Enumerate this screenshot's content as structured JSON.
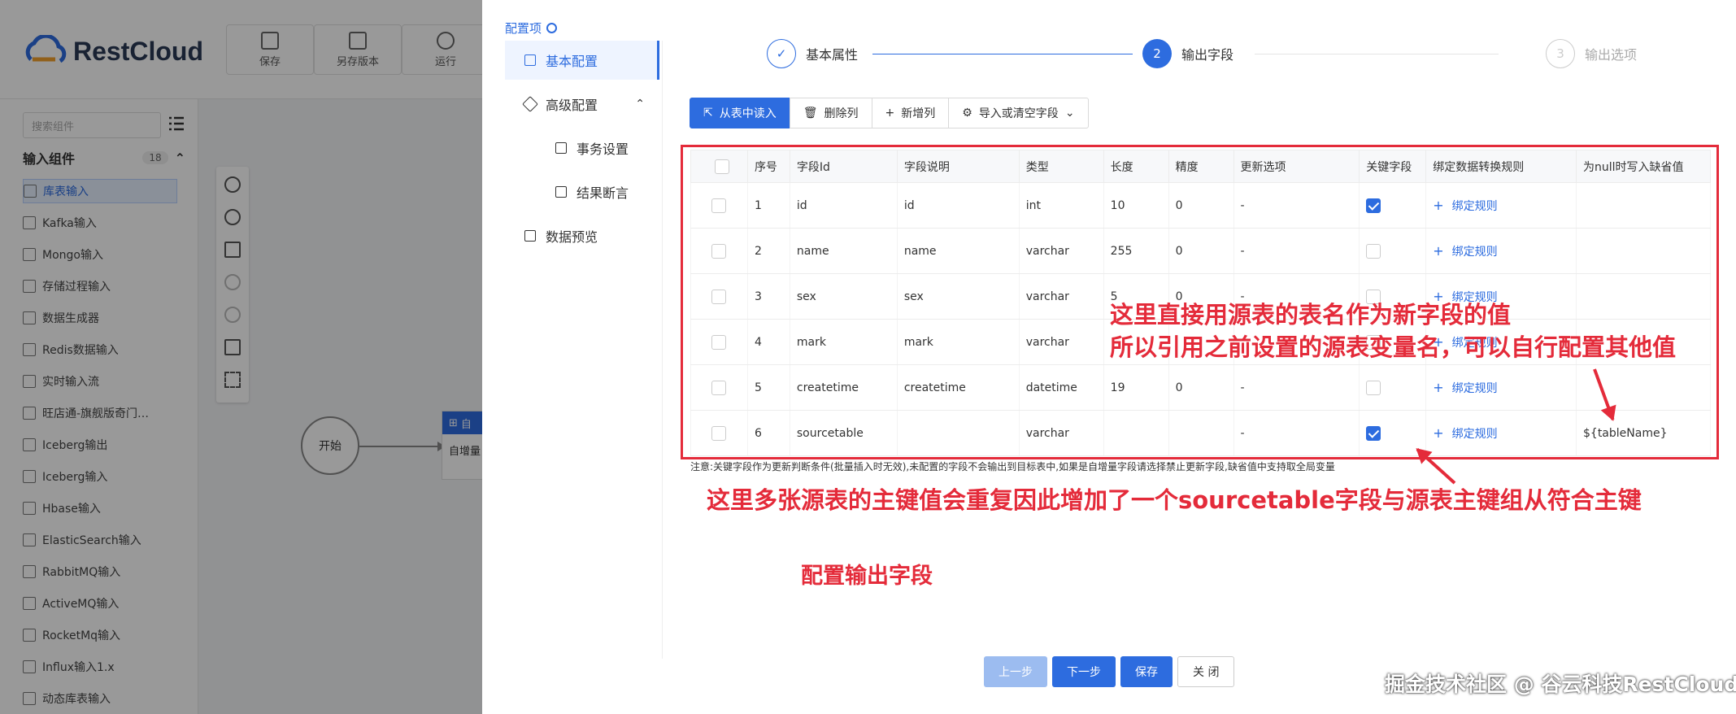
{
  "app": {
    "brand": "RestCloud",
    "toolbar": [
      "保存",
      "另存版本",
      "运行"
    ],
    "search_placeholder": "搜索组件",
    "group": {
      "label": "输入组件",
      "count": "18"
    },
    "components": [
      "库表输入",
      "Kafka输入",
      "Mongo输入",
      "存储过程输入",
      "数据生成器",
      "Redis数据输入",
      "实时输入流",
      "旺店通-旗舰版奇门…",
      "Iceberg输出",
      "Iceberg输入",
      "Hbase输入",
      "ElasticSearch输入",
      "RabbitMQ输入",
      "ActiveMQ输入",
      "RocketMq输入",
      "Influx输入1.x",
      "动态库表输入"
    ],
    "canvas": {
      "start_node": "开始",
      "task_head": "自",
      "task_body": "自增量"
    }
  },
  "dialog": {
    "config_title": "配置项",
    "nav": [
      {
        "label": "基本配置",
        "active": true
      },
      {
        "label": "高级配置",
        "caret": "^"
      },
      {
        "label": "事务设置",
        "sub": true
      },
      {
        "label": "结果断言",
        "sub": true
      },
      {
        "label": "数据预览"
      }
    ],
    "steps": [
      {
        "num": "✓",
        "label": "基本属性",
        "state": "done"
      },
      {
        "num": "2",
        "label": "输出字段",
        "state": "active"
      },
      {
        "num": "3",
        "label": "输出选项",
        "state": "todo"
      }
    ],
    "toolbar": {
      "read": "从表中读入",
      "delete": "删除列",
      "add": "新增列",
      "import": "导入或清空字段"
    },
    "table": {
      "headers": [
        "",
        "序号",
        "字段Id",
        "字段说明",
        "类型",
        "长度",
        "精度",
        "更新选项",
        "关键字段",
        "绑定数据转换规则",
        "为null时写入缺省值"
      ],
      "rows": [
        {
          "no": "1",
          "id": "id",
          "desc": "id",
          "type": "int",
          "len": "10",
          "prec": "0",
          "upd": "-",
          "key": true,
          "rule": "绑定规则",
          "def": ""
        },
        {
          "no": "2",
          "id": "name",
          "desc": "name",
          "type": "varchar",
          "len": "255",
          "prec": "0",
          "upd": "-",
          "key": false,
          "rule": "绑定规则",
          "def": ""
        },
        {
          "no": "3",
          "id": "sex",
          "desc": "sex",
          "type": "varchar",
          "len": "5",
          "prec": "0",
          "upd": "-",
          "key": false,
          "rule": "绑定规则",
          "def": ""
        },
        {
          "no": "4",
          "id": "mark",
          "desc": "mark",
          "type": "varchar",
          "len": "",
          "prec": "",
          "upd": "",
          "key": false,
          "rule": "绑定规则",
          "def": ""
        },
        {
          "no": "5",
          "id": "createtime",
          "desc": "createtime",
          "type": "datetime",
          "len": "19",
          "prec": "0",
          "upd": "-",
          "key": false,
          "rule": "绑定规则",
          "def": ""
        },
        {
          "no": "6",
          "id": "sourcetable",
          "desc": "",
          "type": "varchar",
          "len": "",
          "prec": "",
          "upd": "-",
          "key": true,
          "rule": "绑定规则",
          "def": "${tableName}"
        }
      ]
    },
    "note": "注意:关键字段作为更新判断条件(批量插入时无效),未配置的字段不会输出到目标表中,如果是自增量字段请选择禁止更新字段,缺省值中支持取全局变量",
    "annotations": {
      "a1": "这里直接用源表的表名作为新字段的值",
      "a2": "所以引用之前设置的源表变量名，可以自行配置其他值",
      "a3": "这里多张源表的主键值会重复因此增加了一个sourcetable字段与源表主键组从符合主键",
      "a4": "配置输出字段"
    },
    "footer": {
      "prev": "上一步",
      "next": "下一步",
      "save": "保存",
      "close": "关 闭"
    }
  },
  "watermark": "掘金技术社区 @ 谷云科技RestCloud",
  "colors": {
    "accent": "#2d6cdf",
    "annotation": "#e42b3a"
  }
}
